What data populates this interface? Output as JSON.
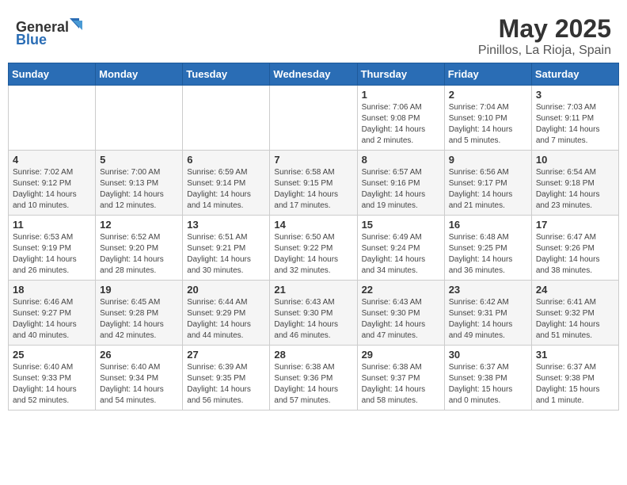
{
  "header": {
    "logo_general": "General",
    "logo_blue": "Blue",
    "month": "May 2025",
    "location": "Pinillos, La Rioja, Spain"
  },
  "weekdays": [
    "Sunday",
    "Monday",
    "Tuesday",
    "Wednesday",
    "Thursday",
    "Friday",
    "Saturday"
  ],
  "weeks": [
    [
      {
        "day": "",
        "sunrise": "",
        "sunset": "",
        "daylight": ""
      },
      {
        "day": "",
        "sunrise": "",
        "sunset": "",
        "daylight": ""
      },
      {
        "day": "",
        "sunrise": "",
        "sunset": "",
        "daylight": ""
      },
      {
        "day": "",
        "sunrise": "",
        "sunset": "",
        "daylight": ""
      },
      {
        "day": "1",
        "sunrise": "Sunrise: 7:06 AM",
        "sunset": "Sunset: 9:08 PM",
        "daylight": "Daylight: 14 hours and 2 minutes."
      },
      {
        "day": "2",
        "sunrise": "Sunrise: 7:04 AM",
        "sunset": "Sunset: 9:10 PM",
        "daylight": "Daylight: 14 hours and 5 minutes."
      },
      {
        "day": "3",
        "sunrise": "Sunrise: 7:03 AM",
        "sunset": "Sunset: 9:11 PM",
        "daylight": "Daylight: 14 hours and 7 minutes."
      }
    ],
    [
      {
        "day": "4",
        "sunrise": "Sunrise: 7:02 AM",
        "sunset": "Sunset: 9:12 PM",
        "daylight": "Daylight: 14 hours and 10 minutes."
      },
      {
        "day": "5",
        "sunrise": "Sunrise: 7:00 AM",
        "sunset": "Sunset: 9:13 PM",
        "daylight": "Daylight: 14 hours and 12 minutes."
      },
      {
        "day": "6",
        "sunrise": "Sunrise: 6:59 AM",
        "sunset": "Sunset: 9:14 PM",
        "daylight": "Daylight: 14 hours and 14 minutes."
      },
      {
        "day": "7",
        "sunrise": "Sunrise: 6:58 AM",
        "sunset": "Sunset: 9:15 PM",
        "daylight": "Daylight: 14 hours and 17 minutes."
      },
      {
        "day": "8",
        "sunrise": "Sunrise: 6:57 AM",
        "sunset": "Sunset: 9:16 PM",
        "daylight": "Daylight: 14 hours and 19 minutes."
      },
      {
        "day": "9",
        "sunrise": "Sunrise: 6:56 AM",
        "sunset": "Sunset: 9:17 PM",
        "daylight": "Daylight: 14 hours and 21 minutes."
      },
      {
        "day": "10",
        "sunrise": "Sunrise: 6:54 AM",
        "sunset": "Sunset: 9:18 PM",
        "daylight": "Daylight: 14 hours and 23 minutes."
      }
    ],
    [
      {
        "day": "11",
        "sunrise": "Sunrise: 6:53 AM",
        "sunset": "Sunset: 9:19 PM",
        "daylight": "Daylight: 14 hours and 26 minutes."
      },
      {
        "day": "12",
        "sunrise": "Sunrise: 6:52 AM",
        "sunset": "Sunset: 9:20 PM",
        "daylight": "Daylight: 14 hours and 28 minutes."
      },
      {
        "day": "13",
        "sunrise": "Sunrise: 6:51 AM",
        "sunset": "Sunset: 9:21 PM",
        "daylight": "Daylight: 14 hours and 30 minutes."
      },
      {
        "day": "14",
        "sunrise": "Sunrise: 6:50 AM",
        "sunset": "Sunset: 9:22 PM",
        "daylight": "Daylight: 14 hours and 32 minutes."
      },
      {
        "day": "15",
        "sunrise": "Sunrise: 6:49 AM",
        "sunset": "Sunset: 9:24 PM",
        "daylight": "Daylight: 14 hours and 34 minutes."
      },
      {
        "day": "16",
        "sunrise": "Sunrise: 6:48 AM",
        "sunset": "Sunset: 9:25 PM",
        "daylight": "Daylight: 14 hours and 36 minutes."
      },
      {
        "day": "17",
        "sunrise": "Sunrise: 6:47 AM",
        "sunset": "Sunset: 9:26 PM",
        "daylight": "Daylight: 14 hours and 38 minutes."
      }
    ],
    [
      {
        "day": "18",
        "sunrise": "Sunrise: 6:46 AM",
        "sunset": "Sunset: 9:27 PM",
        "daylight": "Daylight: 14 hours and 40 minutes."
      },
      {
        "day": "19",
        "sunrise": "Sunrise: 6:45 AM",
        "sunset": "Sunset: 9:28 PM",
        "daylight": "Daylight: 14 hours and 42 minutes."
      },
      {
        "day": "20",
        "sunrise": "Sunrise: 6:44 AM",
        "sunset": "Sunset: 9:29 PM",
        "daylight": "Daylight: 14 hours and 44 minutes."
      },
      {
        "day": "21",
        "sunrise": "Sunrise: 6:43 AM",
        "sunset": "Sunset: 9:30 PM",
        "daylight": "Daylight: 14 hours and 46 minutes."
      },
      {
        "day": "22",
        "sunrise": "Sunrise: 6:43 AM",
        "sunset": "Sunset: 9:30 PM",
        "daylight": "Daylight: 14 hours and 47 minutes."
      },
      {
        "day": "23",
        "sunrise": "Sunrise: 6:42 AM",
        "sunset": "Sunset: 9:31 PM",
        "daylight": "Daylight: 14 hours and 49 minutes."
      },
      {
        "day": "24",
        "sunrise": "Sunrise: 6:41 AM",
        "sunset": "Sunset: 9:32 PM",
        "daylight": "Daylight: 14 hours and 51 minutes."
      }
    ],
    [
      {
        "day": "25",
        "sunrise": "Sunrise: 6:40 AM",
        "sunset": "Sunset: 9:33 PM",
        "daylight": "Daylight: 14 hours and 52 minutes."
      },
      {
        "day": "26",
        "sunrise": "Sunrise: 6:40 AM",
        "sunset": "Sunset: 9:34 PM",
        "daylight": "Daylight: 14 hours and 54 minutes."
      },
      {
        "day": "27",
        "sunrise": "Sunrise: 6:39 AM",
        "sunset": "Sunset: 9:35 PM",
        "daylight": "Daylight: 14 hours and 56 minutes."
      },
      {
        "day": "28",
        "sunrise": "Sunrise: 6:38 AM",
        "sunset": "Sunset: 9:36 PM",
        "daylight": "Daylight: 14 hours and 57 minutes."
      },
      {
        "day": "29",
        "sunrise": "Sunrise: 6:38 AM",
        "sunset": "Sunset: 9:37 PM",
        "daylight": "Daylight: 14 hours and 58 minutes."
      },
      {
        "day": "30",
        "sunrise": "Sunrise: 6:37 AM",
        "sunset": "Sunset: 9:38 PM",
        "daylight": "Daylight: 15 hours and 0 minutes."
      },
      {
        "day": "31",
        "sunrise": "Sunrise: 6:37 AM",
        "sunset": "Sunset: 9:38 PM",
        "daylight": "Daylight: 15 hours and 1 minute."
      }
    ]
  ]
}
